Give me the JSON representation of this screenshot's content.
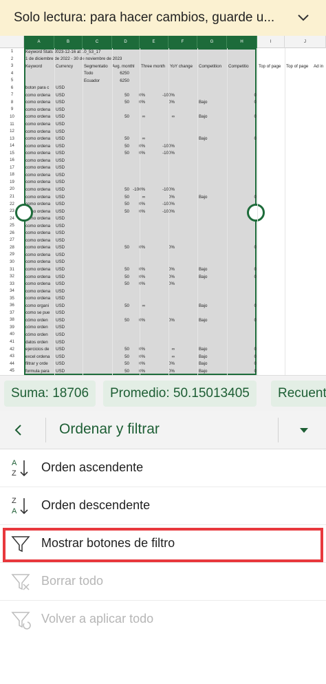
{
  "banner": {
    "text": "Solo lectura: para hacer cambios, guarde u...",
    "icon": "chevron-down-icon"
  },
  "grid": {
    "columns": [
      "A",
      "B",
      "C",
      "D",
      "E",
      "F",
      "G",
      "H",
      "I",
      "J"
    ],
    "rows": [
      "1",
      "2",
      "3",
      "4",
      "5",
      "6",
      "7",
      "8",
      "9",
      "10",
      "11",
      "12",
      "13",
      "14",
      "15",
      "16",
      "17",
      "18",
      "19",
      "20",
      "21",
      "22",
      "23",
      "24",
      "25",
      "26",
      "27",
      "28",
      "29",
      "30",
      "31",
      "32",
      "33",
      "34",
      "35",
      "36",
      "37",
      "38",
      "39",
      "40",
      "41",
      "42",
      "43",
      "44",
      "45"
    ],
    "r1": "Keyword Stats 2023-12-16 at 10_53_17",
    "r2": "1 de diciembre de 2022 - 30 de noviembre de 2023",
    "h_keyword": "Keyword",
    "h_currency": "Currency",
    "h_segmentation": "Segmentatio",
    "h_avg": "Avg. monthl",
    "h_three": "Three month",
    "h_yoy": "YoY change",
    "h_comp": "Competition",
    "h_comp2": "Competitio",
    "h_top1": "Top of page",
    "h_top2": "Top of page",
    "h_ad": "Ad in",
    "todo": "Todo",
    "todo_val": "6250",
    "ecuador": "Ecuador",
    "ecuador_val": "6250",
    "row6_kw": "boton para c",
    "kw_ordena": "como ordena",
    "kw_organi": "como organi",
    "kw_sepue": "como se pue",
    "kw_comoor": "cómo orden",
    "kw_datos": "datos orden",
    "kw_ejerc": "ejercicios de",
    "kw_excel": "excel ordena",
    "kw_filtrar": "filtrar y orde",
    "kw_formula": "formula para",
    "usd": "USD",
    "v50": "50",
    "pct0": "0%",
    "pct100neg": "-100%",
    "dash": "∞",
    "bajo": "Bajo",
    "zero": "0"
  },
  "status": {
    "suma": "Suma: 18706",
    "promedio": "Promedio: 50.15013405",
    "recuento": "Recuent"
  },
  "panel": {
    "title": "Ordenar y filtrar",
    "items": [
      {
        "label": "Orden ascendente",
        "icon": "sort-ascending-icon",
        "enabled": true
      },
      {
        "label": "Orden descendente",
        "icon": "sort-descending-icon",
        "enabled": true
      },
      {
        "label": "Mostrar botones de filtro",
        "icon": "filter-icon",
        "enabled": true
      },
      {
        "label": "Borrar todo",
        "icon": "clear-filter-icon",
        "enabled": false
      },
      {
        "label": "Volver a aplicar todo",
        "icon": "reapply-filter-icon",
        "enabled": false
      }
    ]
  },
  "colors": {
    "accent": "#1d6b3a",
    "highlight": "#e8383d",
    "banner": "#fbf1d1"
  }
}
